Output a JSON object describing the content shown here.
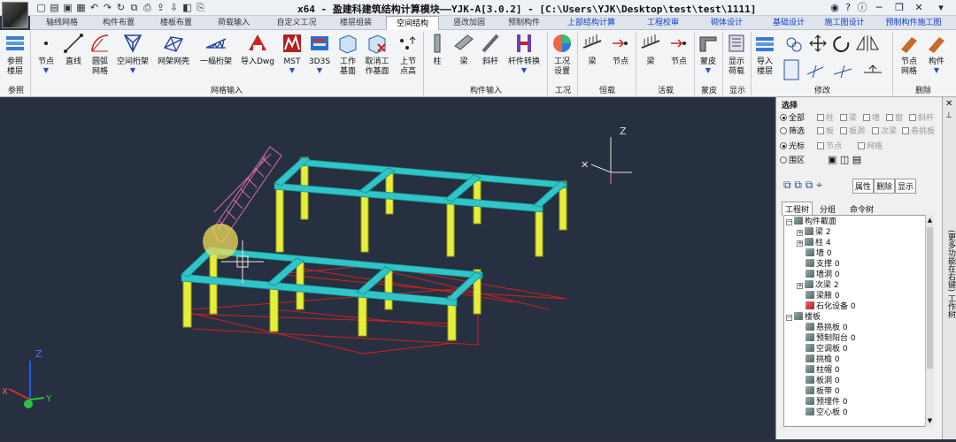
{
  "window": {
    "title": "x64 - 盈建科建筑结构计算模块——YJK-A[3.0.2] - [C:\\Users\\YJK\\Desktop\\test\\test\\1111]",
    "help_symbol": "?"
  },
  "tabs": [
    {
      "label": "轴线网格"
    },
    {
      "label": "构件布置"
    },
    {
      "label": "楼板布置"
    },
    {
      "label": "荷载输入"
    },
    {
      "label": "自定义工况"
    },
    {
      "label": "楼层组装"
    },
    {
      "label": "空间结构"
    },
    {
      "label": "竖改加固"
    },
    {
      "label": "预制构件"
    },
    {
      "label": "上部结构计算"
    },
    {
      "label": "工程校审"
    },
    {
      "label": "砌体设计"
    },
    {
      "label": "基础设计"
    },
    {
      "label": "施工图设计"
    },
    {
      "label": "预制构件施工图"
    }
  ],
  "ribbon": {
    "buttons": [
      {
        "label": "参照\n楼层"
      },
      {
        "label": "节点"
      },
      {
        "label": "直线"
      },
      {
        "label": "圆弧\n网格"
      },
      {
        "label": "空间桁架"
      },
      {
        "label": "网架网壳"
      },
      {
        "label": "一榀桁架"
      },
      {
        "label": "导入Dwg"
      },
      {
        "label": "MST"
      },
      {
        "label": "3D3S"
      },
      {
        "label": "工作\n基面"
      },
      {
        "label": "取消工\n作基面"
      },
      {
        "label": "上节\n点高"
      },
      {
        "label": "柱"
      },
      {
        "label": "梁"
      },
      {
        "label": "斜杆"
      },
      {
        "label": "杆件转换"
      },
      {
        "label": "工况\n设置"
      },
      {
        "label": "梁"
      },
      {
        "label": "节点"
      },
      {
        "label": "梁"
      },
      {
        "label": "节点"
      },
      {
        "label": "蒙皮"
      },
      {
        "label": "显示\n荷载"
      },
      {
        "label": "导入\n楼层"
      },
      {
        "label": "节点\n网格"
      },
      {
        "label": "构件"
      }
    ],
    "groups": [
      {
        "label": "参照"
      },
      {
        "label": "网格输入"
      },
      {
        "label": "构件输入"
      },
      {
        "label": "工况"
      },
      {
        "label": "恒载"
      },
      {
        "label": "活载"
      },
      {
        "label": "蒙皮"
      },
      {
        "label": "显示"
      },
      {
        "label": "修改"
      },
      {
        "label": "删除"
      }
    ]
  },
  "viewport": {
    "axis_z": "Z",
    "axis_x": "X",
    "axis_y": "Y",
    "beam_color": "#2ec6c8",
    "column_color": "#e6ee3a",
    "slab_line_color": "#d22020",
    "truss_color": "#d86ab8"
  },
  "panel": {
    "select_title": "选择",
    "scope": {
      "all": "全部",
      "filter": "筛选"
    },
    "types_row1": [
      "柱",
      "梁",
      "墙",
      "窗",
      "斜杆"
    ],
    "types_row2": [
      "板",
      "板洞",
      "次梁",
      "悬挑板"
    ],
    "cursor_label": "光标",
    "region_label": "围区",
    "types_row3": [
      "节点",
      "网格"
    ],
    "buttons": {
      "properties": "属性",
      "delete": "删除",
      "show": "显示"
    },
    "tree_tabs": [
      "工程树",
      "分组",
      "命令树"
    ],
    "tree": [
      {
        "label": "构件截面"
      },
      {
        "label": "梁 2"
      },
      {
        "label": "柱 4"
      },
      {
        "label": "墙 0"
      },
      {
        "label": "支撑 0"
      },
      {
        "label": "墙洞 0"
      },
      {
        "label": "次梁 2"
      },
      {
        "label": "梁腋 0"
      },
      {
        "label": "石化设备 0"
      },
      {
        "label": "楼板"
      },
      {
        "label": "悬挑板 0"
      },
      {
        "label": "预制阳台 0"
      },
      {
        "label": "空调板 0"
      },
      {
        "label": "挑檐 0"
      },
      {
        "label": "柱帽 0"
      },
      {
        "label": "板洞 0"
      },
      {
        "label": "板带 0"
      },
      {
        "label": "预埋件 0"
      },
      {
        "label": "空心板 0"
      }
    ]
  },
  "side": {
    "label": "(更多功能在右键) 工作树"
  }
}
